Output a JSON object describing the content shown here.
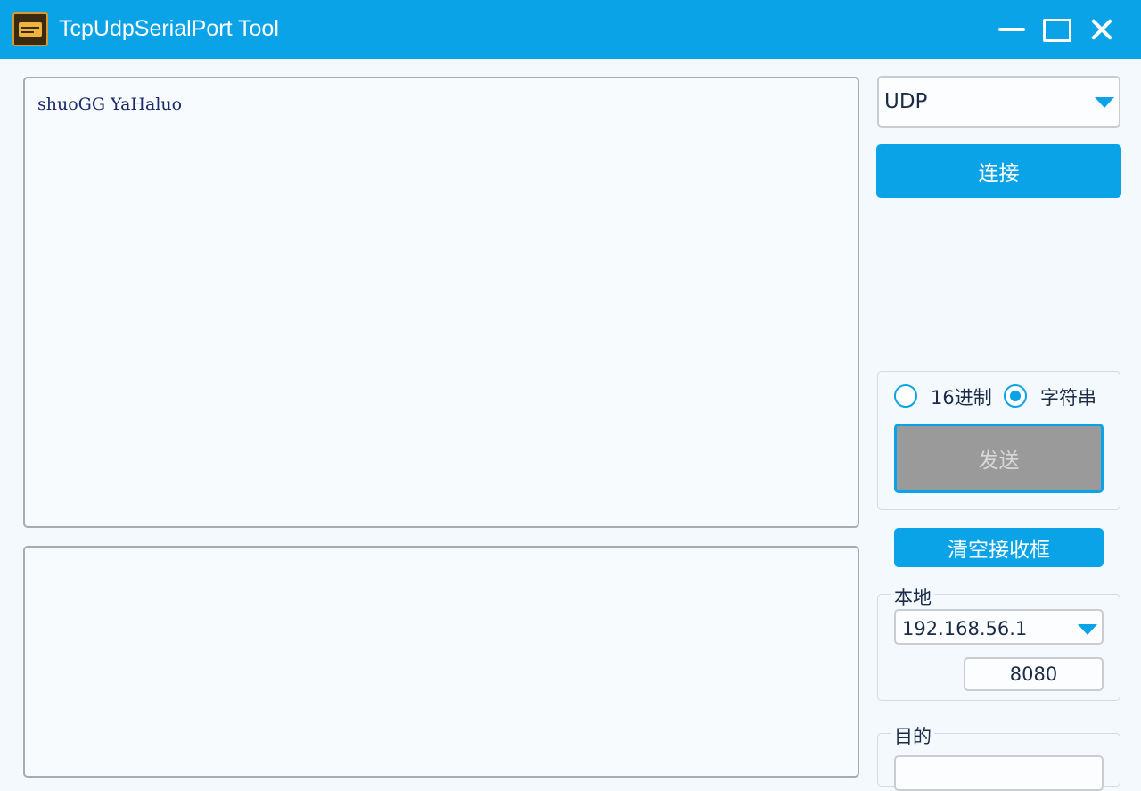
{
  "window": {
    "title": "TcpUdpSerialPort Tool",
    "accent_color": "#0aa3e8",
    "icon": "app-logo-icon",
    "controls": [
      "minimize-icon",
      "maximize-icon",
      "close-icon"
    ]
  },
  "receive": {
    "text": "shuoGG YaHaluo"
  },
  "send_area": {
    "text": ""
  },
  "sidebar": {
    "protocol": "UDP",
    "connect_label": "连接",
    "format_options": {
      "hex_label": "16进制",
      "string_label": "字符串",
      "selected": "string"
    },
    "send_label": "发送",
    "clear_label": "清空接收框",
    "local": {
      "label": "本地",
      "ip": "192.168.56.1",
      "port": "8080"
    },
    "destination": {
      "label": "目的"
    }
  }
}
